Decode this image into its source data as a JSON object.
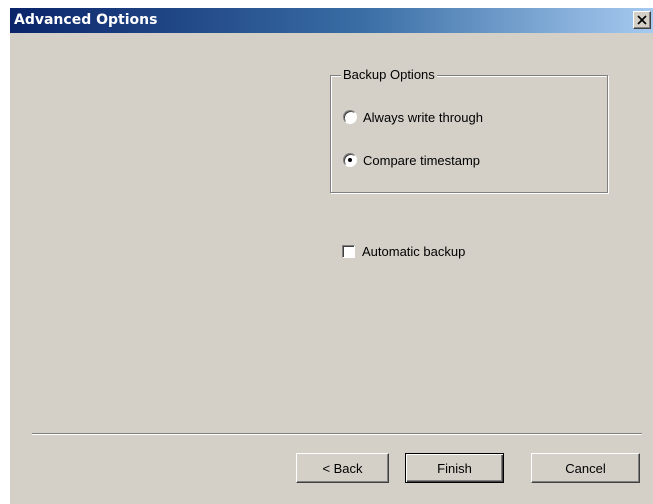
{
  "window": {
    "title": "Advanced Options",
    "close_glyph": "✕"
  },
  "backup_options": {
    "group_label": "Backup Options",
    "radios": [
      {
        "label": "Always write through",
        "checked": false
      },
      {
        "label": "Compare timestamp",
        "checked": true
      }
    ]
  },
  "automatic_backup": {
    "label": "Automatic backup",
    "checked": false
  },
  "buttons": {
    "back": "< Back",
    "finish": "Finish",
    "cancel": "Cancel"
  }
}
